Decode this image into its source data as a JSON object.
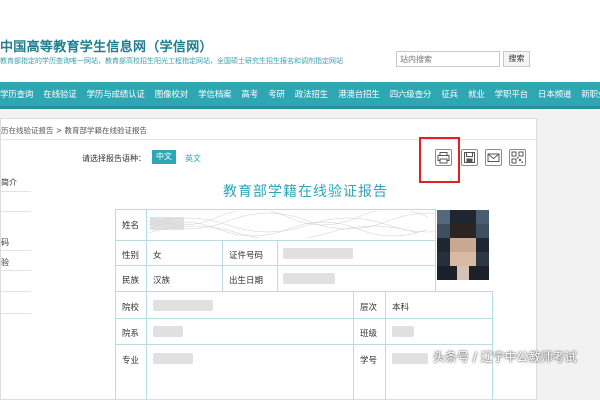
{
  "header": {
    "site_title": "中国高等教育学生信息网（学信网）",
    "site_subtitle": "教育部指定的学历查询唯一网站，教育部高校招生阳光工程指定网站，全国硕士研究生招生报名和调剂指定网站",
    "search_placeholder": "站内搜索",
    "search_button": "搜索"
  },
  "nav": {
    "items": [
      "学历查询",
      "在线验证",
      "学历与成绩认证",
      "图像校对",
      "学信档案",
      "高考",
      "考研",
      "政法招生",
      "港澳台招生",
      "四六级查分",
      "征兵",
      "就业",
      "学职平台",
      "日本频道",
      "新职业"
    ]
  },
  "breadcrumb": "历在线验证报告 > 教育部学籍在线验证报告",
  "sidebar": {
    "items": [
      "简介",
      "码",
      "验"
    ]
  },
  "language": {
    "label": "请选择报告语种：",
    "zh": "中文",
    "en": "英文"
  },
  "toolbar": {
    "icons": [
      "print-icon",
      "download-icon",
      "mail-icon",
      "qrcode-icon"
    ],
    "highlight_color": "#e02020"
  },
  "report": {
    "title": "教育部学籍在线验证报告",
    "rows": {
      "name_label": "姓名",
      "gender_label": "性别",
      "gender_value": "女",
      "id_label": "证件号码",
      "ethnicity_label": "民族",
      "ethnicity_value": "汉族",
      "birth_label": "出生日期",
      "school_label": "院校",
      "level_label": "层次",
      "level_value": "本科",
      "department_label": "院系",
      "class_label": "班级",
      "major_label": "专业",
      "student_no_label": "学号"
    }
  },
  "watermark": "头条号 / 辽宁中公教师考试",
  "colors": {
    "accent": "#2ea6b4",
    "title": "#1f7f8e"
  }
}
